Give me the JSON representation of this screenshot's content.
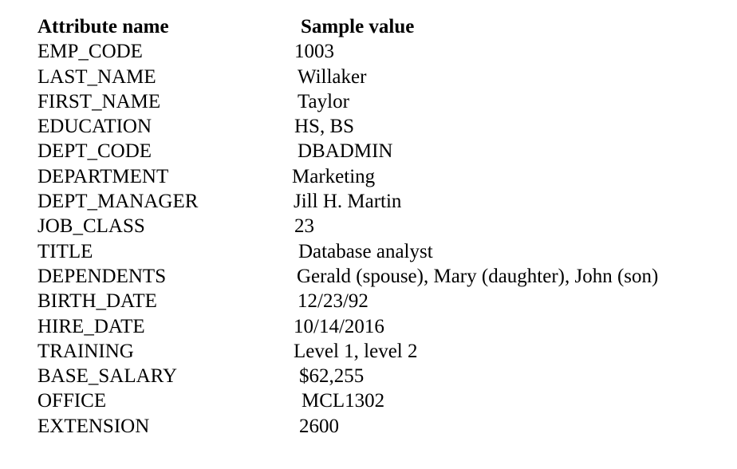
{
  "header": {
    "name": "Attribute name",
    "value": "Sample value"
  },
  "rows": [
    {
      "name": "EMP_CODE",
      "value": "1003"
    },
    {
      "name": "LAST_NAME",
      "value": "Willaker"
    },
    {
      "name": "FIRST_NAME",
      "value": "Taylor"
    },
    {
      "name": "EDUCATION",
      "value": "HS, BS"
    },
    {
      "name": "DEPT_CODE",
      "value": "DBADMIN"
    },
    {
      "name": "DEPARTMENT",
      "value": "Marketing"
    },
    {
      "name": "DEPT_MANAGER",
      "value": "Jill H. Martin"
    },
    {
      "name": "JOB_CLASS",
      "value": "23"
    },
    {
      "name": "TITLE",
      "value": "Database analyst"
    },
    {
      "name": "DEPENDENTS",
      "value": "Gerald (spouse), Mary (daughter), John (son)"
    },
    {
      "name": "BIRTH_DATE",
      "value": "12/23/92"
    },
    {
      "name": "HIRE_DATE",
      "value": "10/14/2016"
    },
    {
      "name": "TRAINING",
      "value": "Level 1, level 2"
    },
    {
      "name": "BASE_SALARY",
      "value": "$62,255"
    },
    {
      "name": "OFFICE",
      "value": "MCL1302"
    },
    {
      "name": "EXTENSION",
      "value": "2600"
    }
  ]
}
